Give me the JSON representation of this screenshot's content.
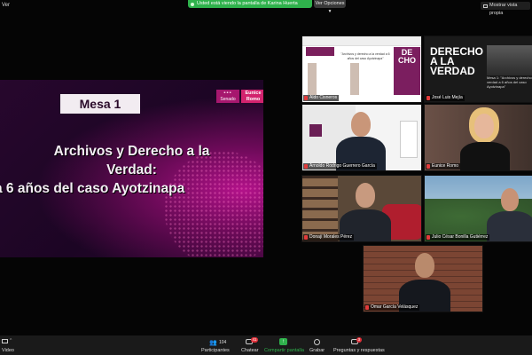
{
  "topbar": {
    "left_label": "Ver",
    "share_banner": "Usted está viendo la pantalla de Karina Huerta",
    "options_label": "Ver Opciones ▾",
    "view_button": "Mostrar vista propia"
  },
  "slide": {
    "mesa": "Mesa 1",
    "senado_logo": "Senado",
    "eunice_logo_line1": "Eunice",
    "eunice_logo_line2": "Romo",
    "title_line1": "Archivos y Derecho a la",
    "title_line2": "Verdad:",
    "title_line3": "a 6 años del caso Ayotzinapa"
  },
  "tiles": [
    {
      "name": "Aldo Cisneros",
      "poster_title": "\"Archivos y derecho a la verdad a 6 años del caso Ayotzinapa\"",
      "side_text": "DE CHO"
    },
    {
      "name": "José Luis Mejía",
      "poster_title": "DERECHO A LA VERDAD",
      "poster_sub": "Mesa 1: \"Archivos y derecho a la verdad a 6 años del caso Ayotzinapa\""
    },
    {
      "name": "Arnoldo Rodrigo Guerrero García"
    },
    {
      "name": "Eunice Romo"
    },
    {
      "name": "Donají Morales Pérez"
    },
    {
      "name": "Julio César Bonilla Gutiérrez"
    },
    {
      "name": "Omar García Velásquez"
    }
  ],
  "toolbar": {
    "video_label": "Video",
    "participants_label": "Participantes",
    "participants_count": "104",
    "chat_label": "Chatear",
    "chat_badge": "41",
    "share_label": "Compartir pantalla",
    "record_label": "Grabar",
    "qa_label": "Preguntas y respuestas",
    "qa_badge": "3"
  },
  "colors": {
    "share_green": "#2fb24c",
    "slide_purple": "#27072d",
    "accent_magenta": "#d2236e"
  }
}
